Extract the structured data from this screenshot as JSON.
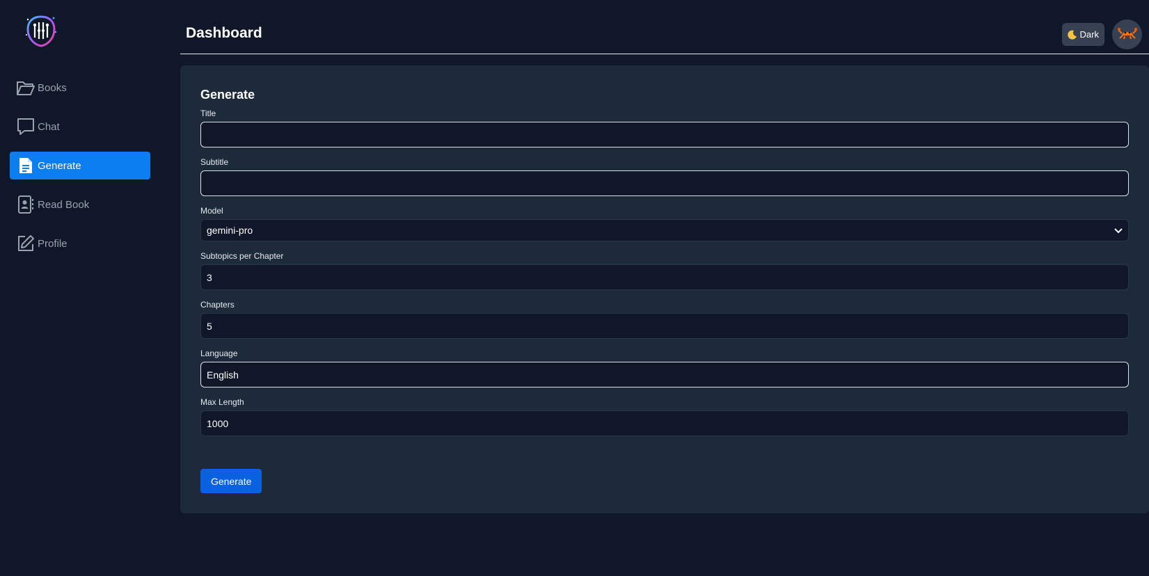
{
  "sidebar": {
    "logo_icon": "brain-book-logo-icon",
    "items": [
      {
        "label": "Books",
        "icon": "folder-open-icon",
        "active": false
      },
      {
        "label": "Chat",
        "icon": "chat-bubble-icon",
        "active": false
      },
      {
        "label": "Generate",
        "icon": "document-icon",
        "active": true
      },
      {
        "label": "Read Book",
        "icon": "contact-book-icon",
        "active": false
      },
      {
        "label": "Profile",
        "icon": "edit-square-icon",
        "active": false
      }
    ]
  },
  "header": {
    "title": "Dashboard",
    "theme_button_label": "Dark",
    "theme_icon": "moon-icon",
    "avatar_icon": "crab-avatar-icon"
  },
  "form": {
    "title": "Generate",
    "fields": {
      "title": {
        "label": "Title",
        "value": ""
      },
      "subtitle": {
        "label": "Subtitle",
        "value": ""
      },
      "model": {
        "label": "Model",
        "value": "gemini-pro"
      },
      "subtopics": {
        "label": "Subtopics per Chapter",
        "value": "3"
      },
      "chapters": {
        "label": "Chapters",
        "value": "5"
      },
      "language": {
        "label": "Language",
        "value": "English"
      },
      "max_length": {
        "label": "Max Length",
        "value": "1000"
      }
    },
    "submit_label": "Generate"
  },
  "colors": {
    "background": "#0f1728",
    "card": "#1d2a39",
    "accent": "#0d7df2",
    "button": "#0b62e0"
  }
}
